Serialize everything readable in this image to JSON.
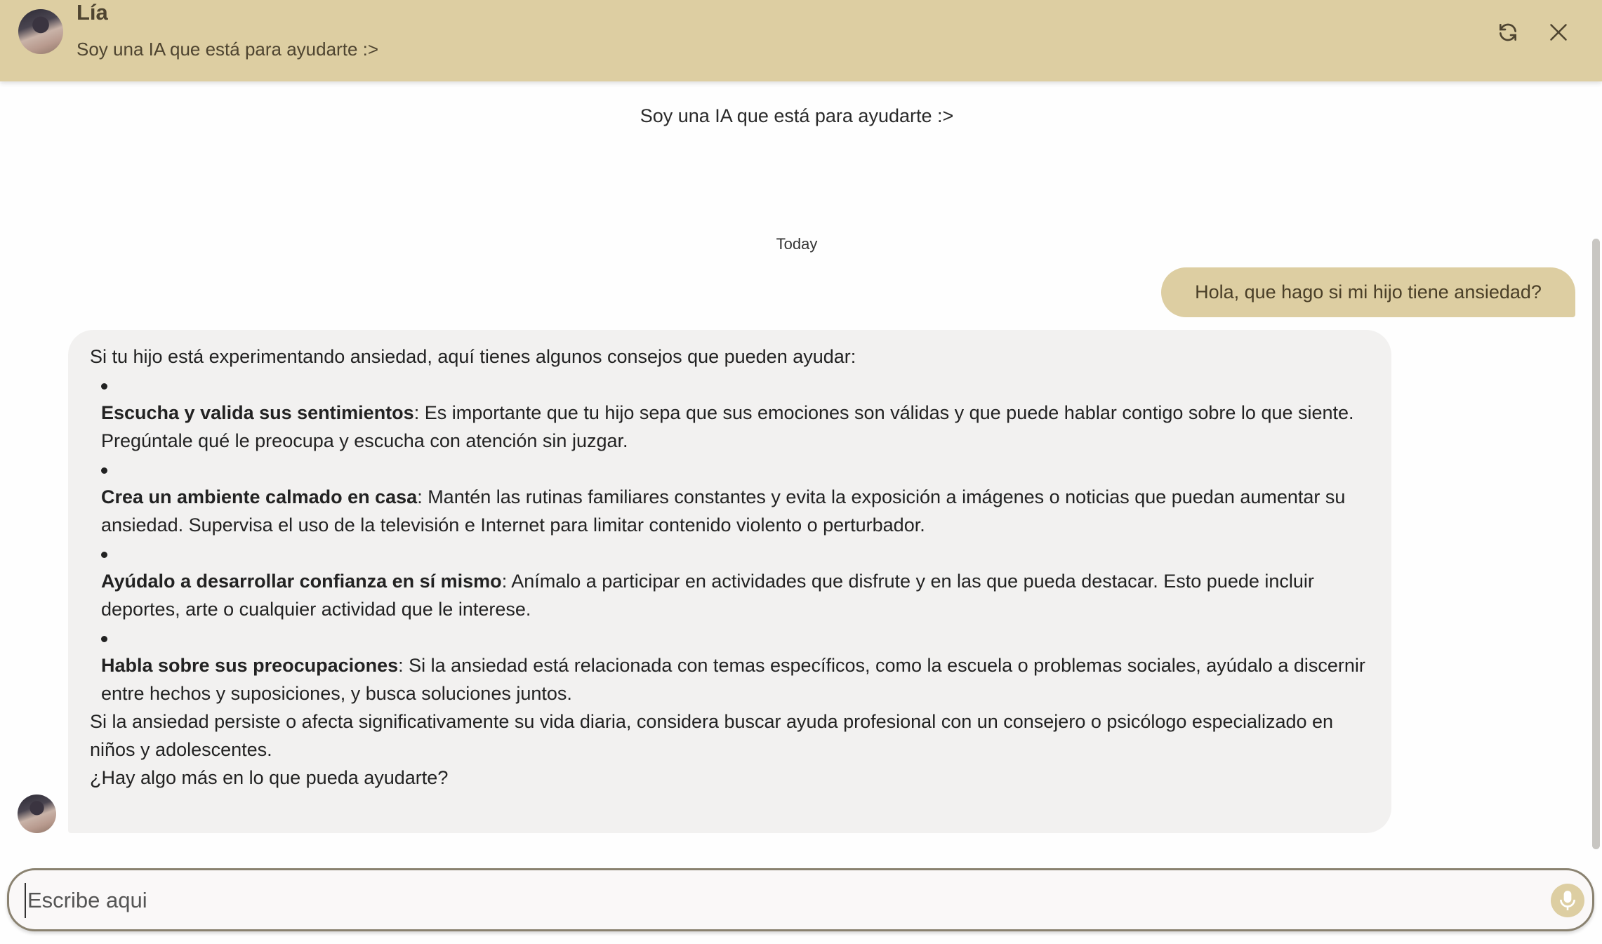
{
  "header": {
    "name": "Lía",
    "subtitle": "Soy una IA que está para ayudarte :>"
  },
  "chat": {
    "intro": "Soy una IA que está para ayudarte :>",
    "date_divider": "Today",
    "user_message": "Hola, que hago si mi hijo tiene ansiedad?",
    "bot_message": {
      "intro": "Si tu hijo está experimentando ansiedad, aquí tienes algunos consejos que pueden ayudar:",
      "items": [
        {
          "title": "Escucha y valida sus sentimientos",
          "text": ": Es importante que tu hijo sepa que sus emociones son válidas y que puede hablar contigo sobre lo que siente. Pregúntale qué le preocupa y escucha con atención sin juzgar."
        },
        {
          "title": "Crea un ambiente calmado en casa",
          "text": ": Mantén las rutinas familiares constantes y evita la exposición a imágenes o noticias que puedan aumentar su ansiedad. Supervisa el uso de la televisión e Internet para limitar contenido violento o perturbador."
        },
        {
          "title": "Ayúdalo a desarrollar confianza en sí mismo",
          "text": ": Anímalo a participar en actividades que disfrute y en las que pueda destacar. Esto puede incluir deportes, arte o cualquier actividad que le interese."
        },
        {
          "title": "Habla sobre sus preocupaciones",
          "text": ": Si la ansiedad está relacionada con temas específicos, como la escuela o problemas sociales, ayúdalo a discernir entre hechos y suposiciones, y busca soluciones juntos."
        }
      ],
      "conclusion": "Si la ansiedad persiste o afecta significativamente su vida diaria, considera buscar ayuda profesional con un consejero o psicólogo especializado en niños y adolescentes.",
      "closing": "¿Hay algo más en lo que pueda ayudarte?"
    }
  },
  "composer": {
    "placeholder": "Escribe aqui",
    "value": ""
  },
  "colors": {
    "accent": "#ddcea2",
    "text_dark": "#4e4430",
    "bubble_bot": "#f2f1f0"
  }
}
